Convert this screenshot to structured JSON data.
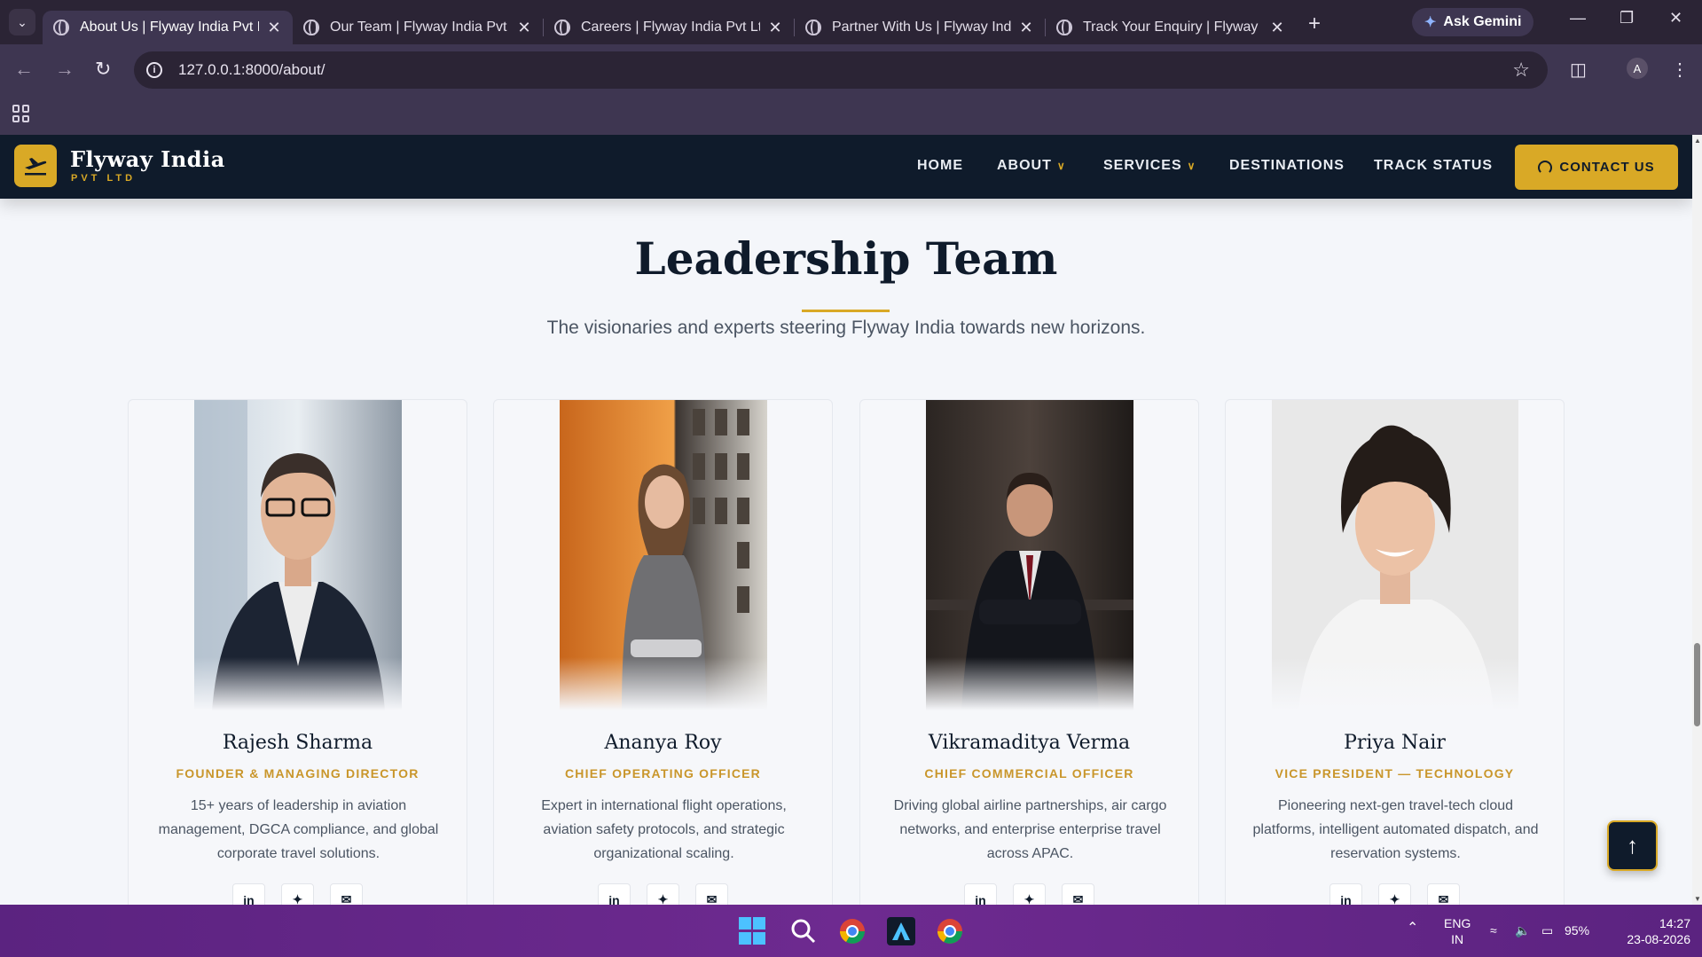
{
  "browser": {
    "tabs": [
      {
        "title": "About Us | Flyway India Pvt Ltd",
        "active": true
      },
      {
        "title": "Our Team | Flyway India Pvt Ltd",
        "active": false
      },
      {
        "title": "Careers | Flyway India Pvt Ltd",
        "active": false
      },
      {
        "title": "Partner With Us | Flyway India",
        "active": false
      },
      {
        "title": "Track Your Enquiry | Flyway India",
        "active": false
      }
    ],
    "gemini_label": "Ask Gemini",
    "url": "127.0.0.1:8000/about/",
    "profile_initial": "A"
  },
  "site": {
    "brand_name": "Flyway India",
    "brand_sub": "PVT LTD",
    "nav": {
      "home": "HOME",
      "about": "ABOUT",
      "services": "SERVICES",
      "destinations": "DESTINATIONS",
      "track": "TRACK STATUS",
      "contact": "CONTACT US"
    },
    "colors": {
      "navy": "#0f1b2b",
      "gold": "#d9a926"
    }
  },
  "section": {
    "title": "Leadership Team",
    "subtitle": "The visionaries and experts steering Flyway India towards new horizons."
  },
  "team": [
    {
      "name": "Rajesh Sharma",
      "role": "FOUNDER & MANAGING DIRECTOR",
      "bio": "15+ years of leadership in aviation management, DGCA compliance, and global corporate travel solutions."
    },
    {
      "name": "Ananya Roy",
      "role": "CHIEF OPERATING OFFICER",
      "bio": "Expert in international flight operations, aviation safety protocols, and strategic organizational scaling."
    },
    {
      "name": "Vikramaditya Verma",
      "role": "CHIEF COMMERCIAL OFFICER",
      "bio": "Driving global airline partnerships, air cargo networks, and enterprise enterprise travel across APAC."
    },
    {
      "name": "Priya Nair",
      "role": "VICE PRESIDENT — TECHNOLOGY",
      "bio": "Pioneering next-gen travel-tech cloud platforms, intelligent automated dispatch, and reservation systems."
    }
  ],
  "social_icons": {
    "linkedin": "in",
    "twitter": "twitter-icon",
    "email": "email-icon"
  },
  "taskbar": {
    "lang_top": "ENG",
    "lang_bottom": "IN",
    "battery": "95%",
    "time": "14:27",
    "date": "23-08-2026"
  }
}
